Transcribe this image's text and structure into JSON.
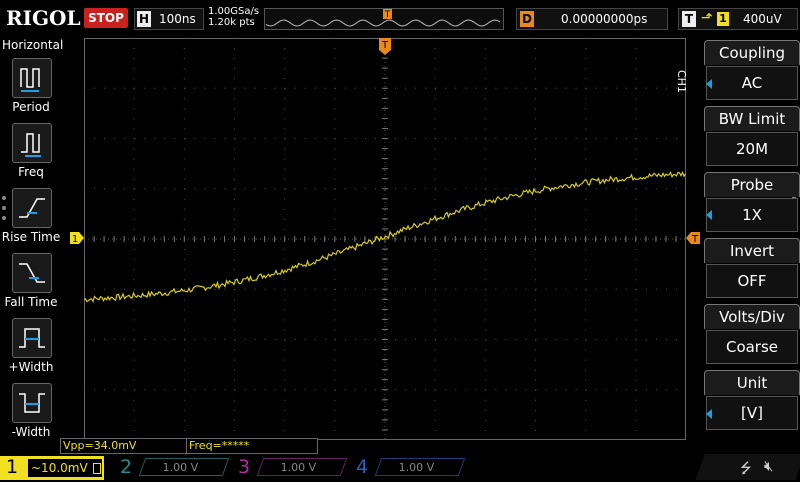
{
  "top": {
    "brand": "RIGOL",
    "run_state": "STOP",
    "timebase_key": "H",
    "timebase": "100ns",
    "sample_rate": "1.00GSa/s",
    "mem_depth": "1.20k pts",
    "trigger_pos_marker": "T",
    "delay_key": "D",
    "delay": "0.00000000ps",
    "trigger_key": "T",
    "trigger_edge_icon": "rising-edge-icon",
    "trigger_source": "1",
    "trigger_level": "400uV"
  },
  "left_menu": {
    "title": "Horizontal",
    "items": [
      {
        "label": "Period",
        "icon": "period-icon"
      },
      {
        "label": "Freq",
        "icon": "frequency-icon"
      },
      {
        "label": "Rise Time",
        "icon": "rise-time-icon"
      },
      {
        "label": "Fall Time",
        "icon": "fall-time-icon"
      },
      {
        "label": "+Width",
        "icon": "positive-width-icon"
      },
      {
        "label": "-Width",
        "icon": "negative-width-icon"
      }
    ]
  },
  "right_menu": {
    "channel_label": "CH1",
    "items": [
      {
        "title": "Coupling",
        "value": "AC",
        "has_arrow": true
      },
      {
        "title": "BW Limit",
        "value": "20M",
        "has_arrow": false
      },
      {
        "title": "Probe",
        "value": "1X",
        "has_arrow": true
      },
      {
        "title": "Invert",
        "value": "OFF",
        "has_arrow": false
      },
      {
        "title": "Volts/Div",
        "value": "Coarse",
        "has_arrow": false
      },
      {
        "title": "Unit",
        "value": "[V]",
        "has_arrow": true
      }
    ]
  },
  "measurements": {
    "vpp": "Vpp=34.0mV",
    "freq": "Freq=*****"
  },
  "bottom": {
    "channels": [
      {
        "num": "1",
        "scale": "~10.0mV",
        "active": true,
        "color": "#f0e020"
      },
      {
        "num": "2",
        "scale": "1.00 V",
        "active": false,
        "color": "#1f8f8f"
      },
      {
        "num": "3",
        "scale": "1.00 V",
        "active": false,
        "color": "#b02aa0"
      },
      {
        "num": "4",
        "scale": "1.00 V",
        "active": false,
        "color": "#2a5fc0"
      }
    ]
  },
  "waveform": {
    "color": "#d8cc20",
    "shape": "rising-s-curve",
    "start_level_div": -1.2,
    "end_level_div": 1.3
  },
  "markers": {
    "trigger_top": "T",
    "ch1_ground": "1",
    "trigger_level_marker": "T"
  }
}
